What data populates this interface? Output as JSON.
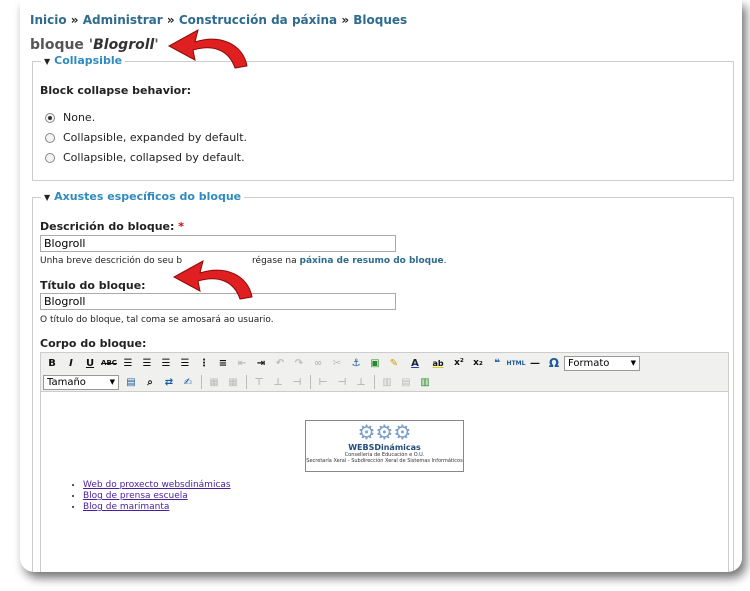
{
  "breadcrumb": {
    "items": [
      "Inicio",
      "Administrar",
      "Construcción da páxina",
      "Bloques"
    ],
    "sep": "»"
  },
  "page_title": {
    "prefix": "bloque '",
    "name": "Blogroll",
    "suffix": "'"
  },
  "collapsible": {
    "legend": "Collapsible",
    "heading": "Block collapse behavior:",
    "options": [
      {
        "label": "None.",
        "checked": true
      },
      {
        "label": "Collapsible, expanded by default.",
        "checked": false
      },
      {
        "label": "Collapsible, collapsed by default.",
        "checked": false
      }
    ]
  },
  "settings": {
    "legend": "Axustes específicos do bloque",
    "description_label": "Descrición do bloque:",
    "required_mark": "*",
    "description_value": "Blogroll",
    "description_help_prefix": "Unha breve descrición do seu b",
    "description_help_mid": "régase na",
    "description_help_link": "páxina de resumo do bloque",
    "description_help_suffix": ".",
    "title_label": "Título do bloque:",
    "title_value": "Blogroll",
    "title_help": "O título do bloque, tal coma se amosará ao usuario.",
    "body_label": "Corpo do bloque:"
  },
  "toolbar": {
    "row1": [
      "B",
      "I",
      "U",
      "ABC",
      "align-left-icon",
      "align-center-icon",
      "align-right-icon",
      "justify-icon",
      "bullet-list-icon",
      "number-list-icon",
      "outdent-icon",
      "indent-icon",
      "undo-icon",
      "redo-icon",
      "link-icon",
      "unlink-icon",
      "anchor-icon",
      "image-icon",
      "cleanup-icon",
      "A",
      "ab",
      "x²",
      "x₂",
      "quote-icon",
      "HTML",
      "hr-icon",
      "Ω"
    ],
    "format_select": "Formato",
    "size_select": "Tamaño"
  },
  "editor": {
    "logo": {
      "brand": "WEBSDinámicas",
      "sub1": "Consellería de Educación e O.U.",
      "sub2": "Secretaría Xeral - Subdirección Xeral de Sistemas Informáticos"
    },
    "links": [
      "Web do proxecto websdinámicas",
      "Blog de prensa escuela",
      "Blog de marimanta"
    ]
  },
  "colors": {
    "link": "#2e6b8f",
    "legend": "#2e8bbf",
    "arrow": "#e02020",
    "visited": "#4a1ea0"
  }
}
